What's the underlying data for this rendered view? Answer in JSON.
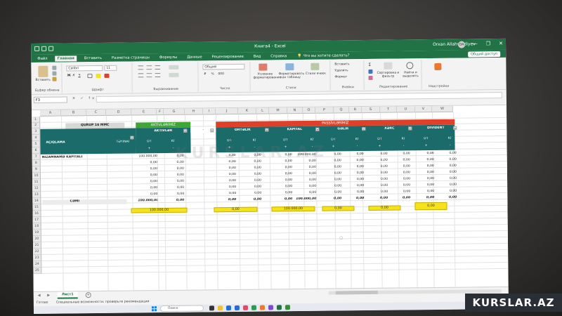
{
  "window": {
    "title": "Книга4 - Excel",
    "user": "Orxan Allahverdiyev",
    "avatar_initials": "OA",
    "min": "—",
    "restore": "❐",
    "close": "✕"
  },
  "menu": {
    "tabs": [
      "Файл",
      "Главная",
      "Вставить",
      "Разметка страницы",
      "Формулы",
      "Данные",
      "Рецензирование",
      "Вид",
      "Справка"
    ],
    "active": "Главная",
    "tell_me": "Что вы хотите сделать?",
    "share": "Общий доступ"
  },
  "ribbon": {
    "clipboard": {
      "paste": "Вставить",
      "label": "Буфер обмена"
    },
    "font": {
      "name": "Calibri",
      "size": "11",
      "label": "Шрифт",
      "bold": "Ж",
      "italic": "К",
      "underline": "Ч"
    },
    "alignment": {
      "label": "Выравнивание"
    },
    "number": {
      "format": "Общий",
      "label": "Число",
      "percent": "%",
      "thousands": "000"
    },
    "styles": {
      "conditional": "Условное форматирование",
      "as_table": "Форматировать как таблицу",
      "cell_styles": "Стили ячеек",
      "label": "Стили"
    },
    "cells": {
      "insert": "Вставить",
      "delete": "Удалить",
      "format": "Формат",
      "label": "Ячейки"
    },
    "editing": {
      "sort": "Сортировка и фильтр",
      "find": "Найти и выделить",
      "label": "Редактирование"
    },
    "addins": {
      "label": "Надстройки"
    }
  },
  "formula_bar": {
    "name_box": "F3",
    "fx": "✕ ✓ fx",
    "content": ""
  },
  "columns": [
    "A",
    "B",
    "C",
    "D",
    "E",
    "F",
    "G",
    "H",
    "I",
    "J",
    "K",
    "L",
    "M",
    "N",
    "O",
    "P",
    "Q",
    "R",
    "S",
    "T",
    "U",
    "V",
    "W"
  ],
  "rows": [
    "1",
    "2",
    "3",
    "4",
    "5",
    "6",
    "7",
    "8",
    "9",
    "10",
    "11",
    "12",
    "13",
    "14",
    "15",
    "16",
    "17",
    "18",
    "19",
    "20",
    "21",
    "22",
    "23",
    "24",
    "25"
  ],
  "sheet": {
    "company": "QURUP 16 MMC",
    "assets_band": "AKTİVLƏRİMİZ",
    "liabilities_band": "PASSİVLƏRİMİZ",
    "headers": {
      "aciqlama": "AÇIQLAMA",
      "teyinat": "TƏYİNAT",
      "aktivler": "AKTİVLƏR",
      "ohdelik": "ÖHTƏLİK",
      "kapital": "KAPİTAL",
      "gelir": "GƏLİR",
      "xerc": "XƏRC",
      "divident": "DİVİDENT",
      "dt": "DT",
      "kt": "KT",
      "plus": "+",
      "minus": "-"
    },
    "row_label": "NİZAMNAMƏ KAPİTALI",
    "total_label": "CƏMİ",
    "data_rows": [
      {
        "d": "100.000,00",
        "e": "0,00",
        "g": "0,00",
        "h": "0,00",
        "j": "0,00",
        "k": "100.000,00",
        "m": "0,00",
        "n": "0,00",
        "p": "0,00",
        "q": "0,00",
        "s": "0,00",
        "t": "0,00"
      },
      {
        "d": "0,00",
        "e": "0,00",
        "g": "0,00",
        "h": "0,00",
        "j": "0,00",
        "k": "0,00",
        "m": "0,00",
        "n": "0,00",
        "p": "0,00",
        "q": "0,00",
        "s": "0,00",
        "t": "0,00"
      },
      {
        "d": "0,00",
        "e": "0,00",
        "g": "0,00",
        "h": "0,00",
        "j": "0,00",
        "k": "0,00",
        "m": "0,00",
        "n": "0,00",
        "p": "0,00",
        "q": "0,00",
        "s": "0,00",
        "t": "0,00"
      },
      {
        "d": "0,00",
        "e": "0,00",
        "g": "0,00",
        "h": "0,00",
        "j": "0,00",
        "k": "0,00",
        "m": "0,00",
        "n": "0,00",
        "p": "0,00",
        "q": "0,00",
        "s": "0,00",
        "t": "0,00"
      },
      {
        "d": "0,00",
        "e": "0,00",
        "g": "0,00",
        "h": "0,00",
        "j": "0,00",
        "k": "0,00",
        "m": "0,00",
        "n": "0,00",
        "p": "0,00",
        "q": "0,00",
        "s": "0,00",
        "t": "0,00"
      },
      {
        "d": "0,00",
        "e": "0,00",
        "g": "0,00",
        "h": "0,00",
        "j": "0,00",
        "k": "0,00",
        "m": "0,00",
        "n": "0,00",
        "p": "0,00",
        "q": "0,00",
        "s": "0,00",
        "t": "0,00"
      },
      {
        "d": "0,00",
        "e": "0,00",
        "g": "0,00",
        "h": "0,00",
        "j": "0,00",
        "k": "0,00",
        "m": "0,00",
        "n": "0,00",
        "p": "0,00",
        "q": "0,00",
        "s": "0,00",
        "t": "0,00"
      }
    ],
    "totals": {
      "d": "100.000,00",
      "e": "0,00",
      "g": "0,00",
      "h": "0,00",
      "j": "0,00",
      "k": "100.000,00",
      "m": "0,00",
      "n": "0,00",
      "p": "0,00",
      "q": "0,00",
      "s": "0,00",
      "t": "0,00"
    },
    "balances": {
      "assets": "100.000,00",
      "ohdelik": "0,00",
      "kapital": "100.000,00",
      "gelir": "0,00",
      "xerc": "0,00",
      "divident": "0,00"
    },
    "watermark": "KURSLAR.AZ"
  },
  "sheet_tabs": {
    "active": "Лист1",
    "add": "+",
    "nav": "◀ ▶"
  },
  "status": {
    "ready": "Готово",
    "accessibility": "Специальные возможности: проверьте рекомендации",
    "zoom": "100%"
  },
  "taskbar": {
    "search": "Поиск",
    "tray": "AZE"
  },
  "colors": {
    "excel_green": "#217346",
    "teal": "#1b6b6a",
    "assets_green": "#3fa535",
    "liabilities_red": "#e0402a",
    "yellow": "#f6e21a"
  },
  "brand": "KURSLAR.AZ"
}
